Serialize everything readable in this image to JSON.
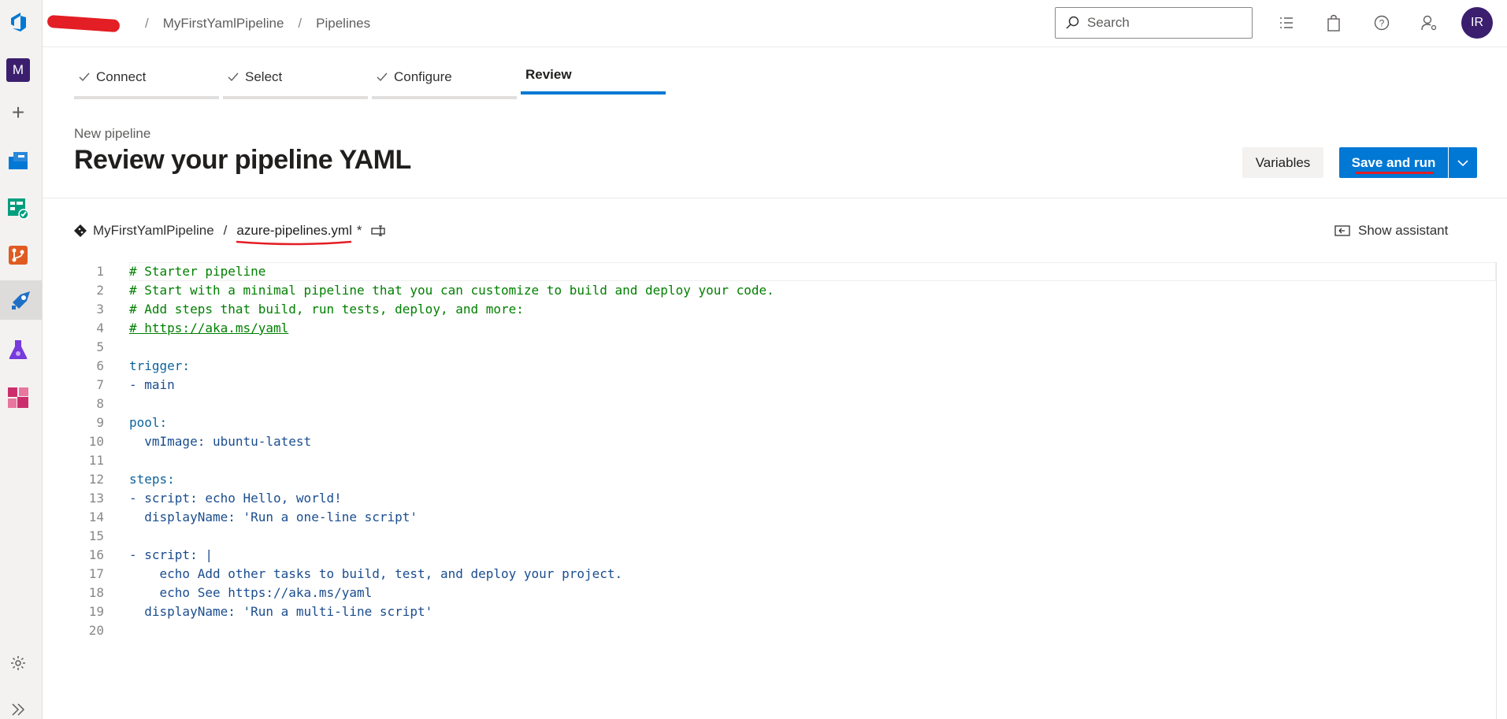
{
  "topbar": {
    "breadcrumb": [
      "MyFirstYamlPipeline",
      "Pipelines"
    ],
    "search_placeholder": "Search",
    "avatar_initials": "IR"
  },
  "rail": {
    "org_initial": "M"
  },
  "wizard": {
    "steps": [
      {
        "label": "Connect",
        "state": "done"
      },
      {
        "label": "Select",
        "state": "done"
      },
      {
        "label": "Configure",
        "state": "done"
      },
      {
        "label": "Review",
        "state": "current"
      }
    ]
  },
  "header": {
    "subtitle": "New pipeline",
    "title": "Review your pipeline YAML",
    "variables_label": "Variables",
    "save_run_label": "Save and run"
  },
  "file": {
    "repo": "MyFirstYamlPipeline",
    "separator": "/",
    "filename": "azure-pipelines.yml",
    "dirty_marker": "*",
    "show_assistant_label": "Show assistant"
  },
  "editor": {
    "lines": [
      "# Starter pipeline",
      "# Start with a minimal pipeline that you can customize to build and deploy your code.",
      "# Add steps that build, run tests, deploy, and more:",
      "# https://aka.ms/yaml",
      "",
      "trigger:",
      "- main",
      "",
      "pool:",
      "  vmImage: ubuntu-latest",
      "",
      "steps:",
      "- script: echo Hello, world!",
      "  displayName: 'Run a one-line script'",
      "",
      "- script: |",
      "    echo Add other tasks to build, test, and deploy your project.",
      "    echo See https://aka.ms/yaml",
      "  displayName: 'Run a multi-line script'",
      ""
    ]
  },
  "colors": {
    "accent": "#0078d4",
    "org_badge": "#3b1f6e",
    "annotation_red": "#e31e24"
  }
}
